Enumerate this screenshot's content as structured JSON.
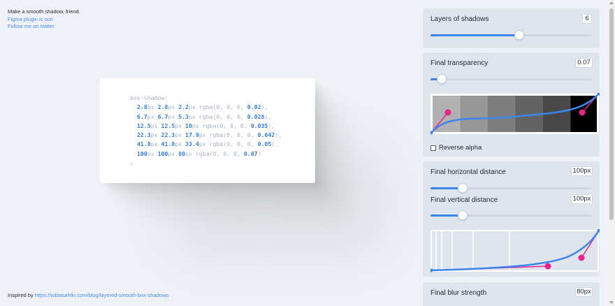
{
  "header": {
    "tagline": "Make a smooth shadow, friend.",
    "figma_link": "Figma plugin is out!",
    "twitter_link": "Follow me on twitter"
  },
  "footer": {
    "prefix": "Inspired by ",
    "link": "https://tobiasahlin.com/blog/layered-smooth-box-shadows"
  },
  "code": {
    "property": "box-shadow:",
    "terminator": ";",
    "lines": [
      {
        "x": "2.8",
        "y": "2.8",
        "blur": "2.2",
        "alpha": "0.02",
        "sep": ","
      },
      {
        "x": "6.7",
        "y": "6.7",
        "blur": "5.3",
        "alpha": "0.028",
        "sep": ","
      },
      {
        "x": "12.5",
        "y": "12.5",
        "blur": "10",
        "alpha": "0.035",
        "sep": ","
      },
      {
        "x": "22.3",
        "y": "22.3",
        "blur": "17.9",
        "alpha": "0.042",
        "sep": ","
      },
      {
        "x": "41.8",
        "y": "41.8",
        "blur": "33.4",
        "alpha": "0.05",
        "sep": ","
      },
      {
        "x": "100",
        "y": "100",
        "blur": "80",
        "alpha": "0.07",
        "sep": ""
      }
    ]
  },
  "controls": {
    "layers": {
      "label": "Layers of shadows",
      "value": "6",
      "fraction": 0.55
    },
    "transparency": {
      "label": "Final transparency",
      "value": "0.07",
      "fraction": 0.07
    },
    "reverse_alpha": {
      "label": "Reverse alpha",
      "checked": false
    },
    "horizontal": {
      "label": "Final horizontal distance",
      "value": "100px",
      "fraction": 0.2
    },
    "vertical": {
      "label": "Final vertical distance",
      "value": "100px",
      "fraction": 0.2
    },
    "blur": {
      "label": "Final blur strength",
      "value": "80px"
    }
  },
  "colors": {
    "accent": "#3b86ec",
    "handle": "#e8238e",
    "link": "#4a8de8"
  }
}
